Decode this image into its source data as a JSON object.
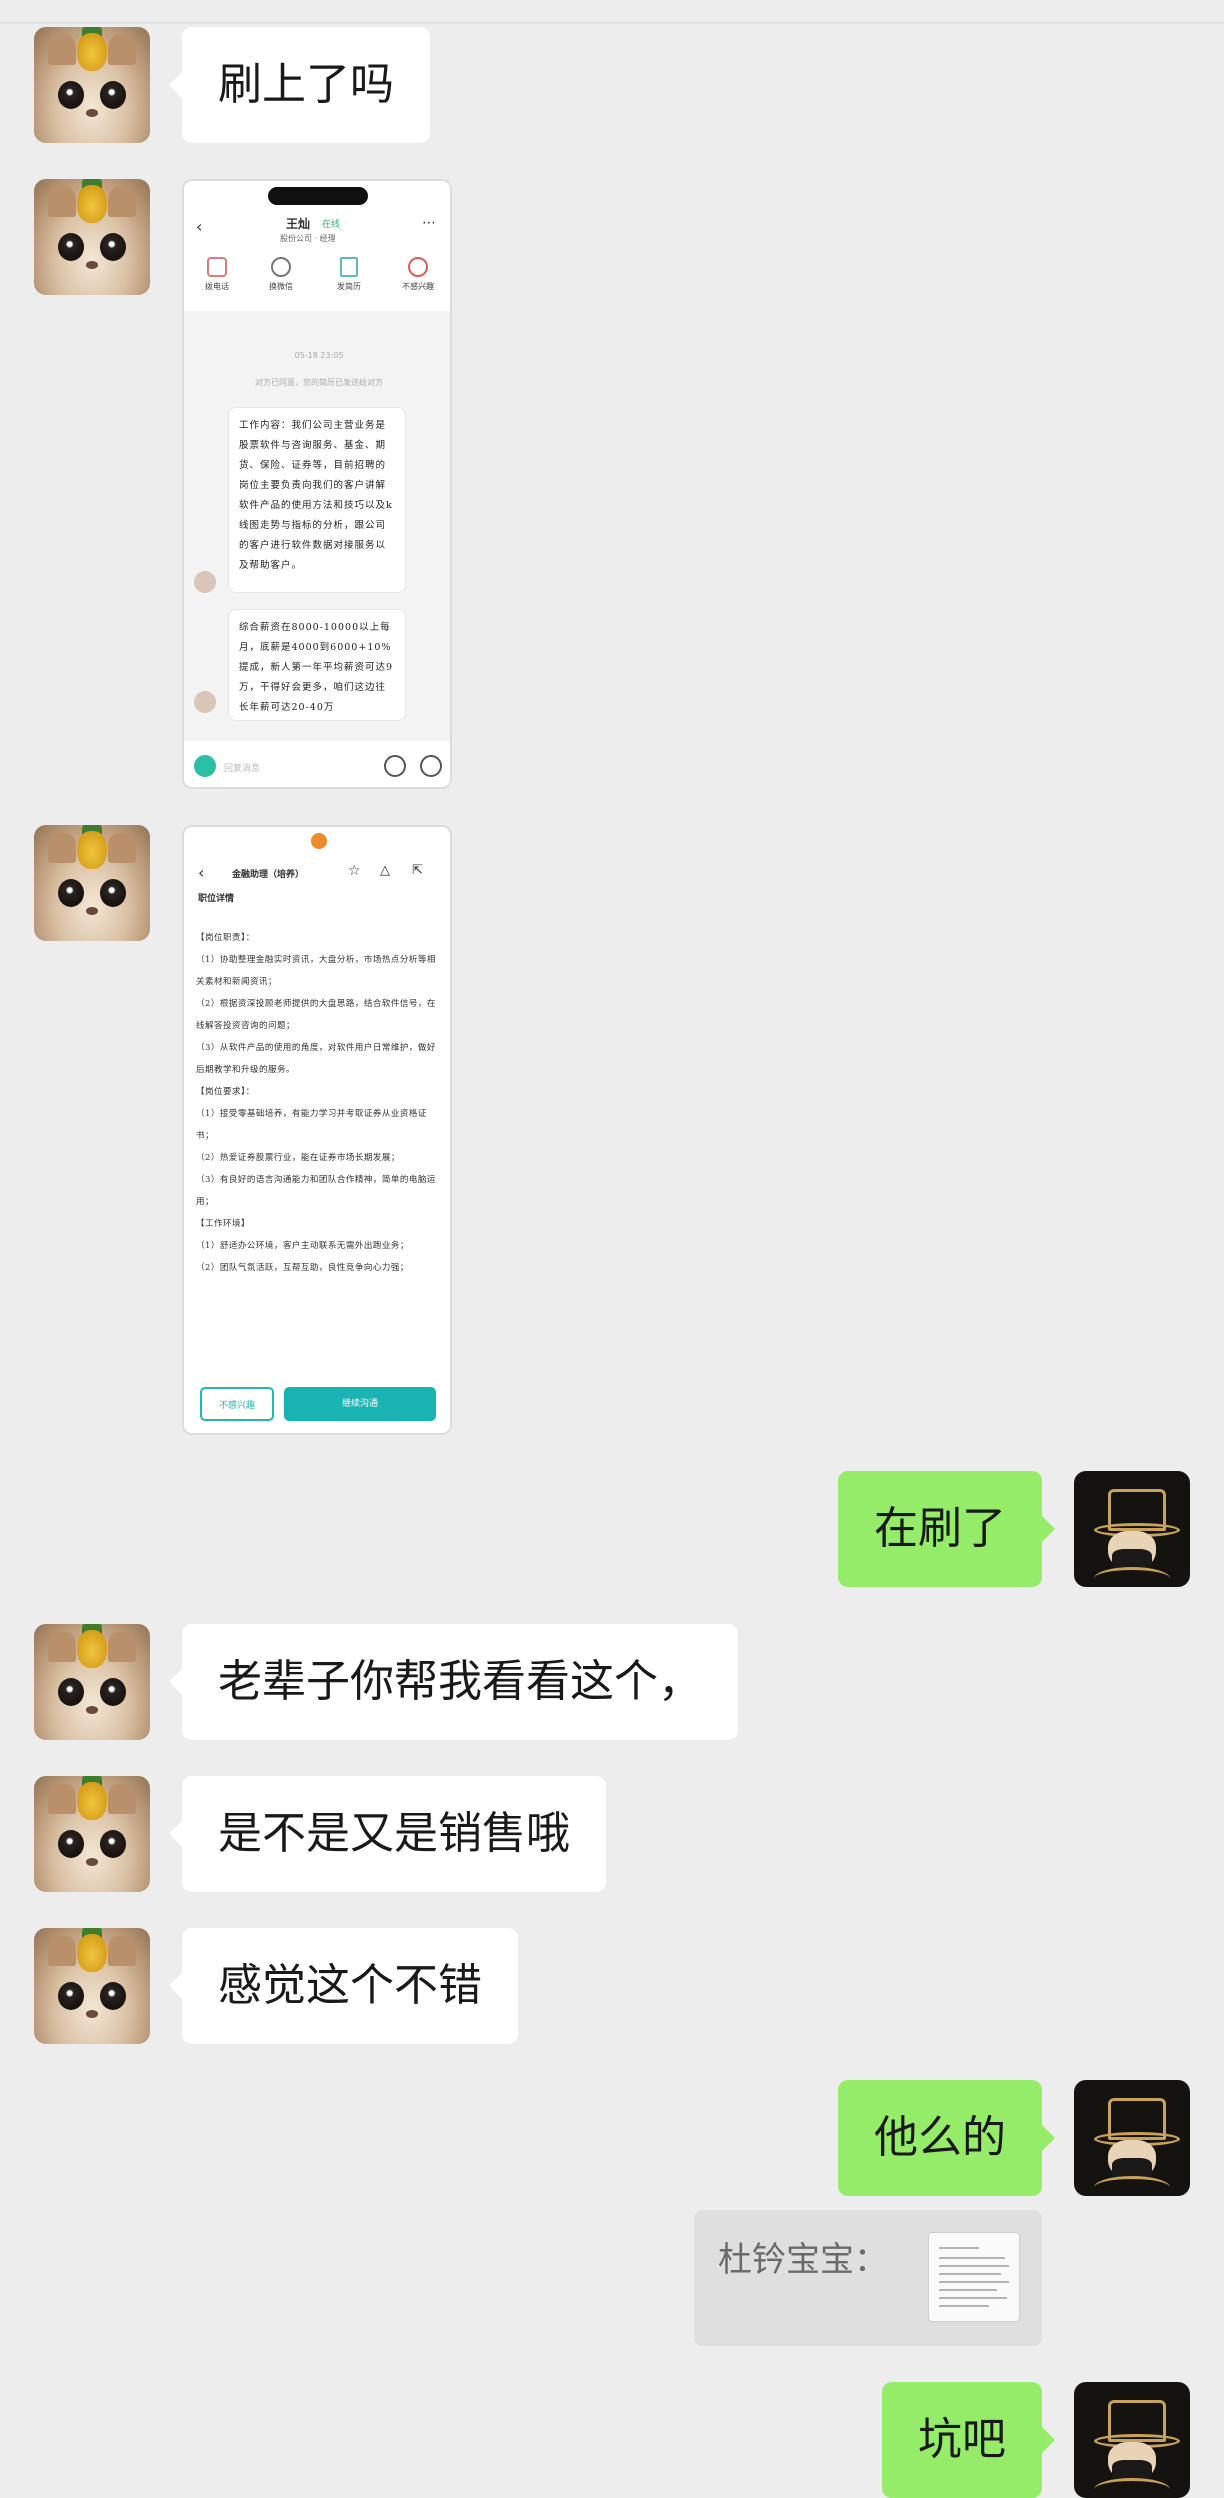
{
  "messages": [
    {
      "side": "in",
      "text": "刷上了吗"
    },
    {
      "side": "in",
      "type": "image",
      "label": "screenshot-chat"
    },
    {
      "side": "in",
      "type": "image",
      "label": "screenshot-job"
    },
    {
      "side": "out",
      "text": "在刷了"
    },
    {
      "side": "in",
      "text": "老辈子你帮我看看这个，"
    },
    {
      "side": "in",
      "text": "是不是又是销售哦"
    },
    {
      "side": "in",
      "text": "感觉这个不错"
    },
    {
      "side": "out",
      "text": "他么的"
    },
    {
      "side": "out",
      "type": "quote",
      "text": "杜钤宝宝："
    },
    {
      "side": "out",
      "text": "坑吧"
    }
  ],
  "shot1": {
    "name": "王灿",
    "online": "在线",
    "subtitle": "股份公司 · 经理",
    "actions": [
      "拨电话",
      "换微信",
      "发简历",
      "不感兴趣"
    ],
    "timestamp": "05-18 23:05",
    "notice": "对方已同意，您的简历已发送给对方",
    "bubble1": "工作内容：我们公司主营业务是股票软件与咨询服务、基金、期货、保险、证券等，目前招聘的岗位主要负责向我们的客户讲解软件产品的使用方法和技巧以及k线图走势与指标的分析，跟公司的客户进行软件数据对接服务以及帮助客户。",
    "bubble2": "综合薪资在8000-10000以上每月，底薪是4000到6000+10%提成，新人第一年平均薪资可达9万，干得好会更多，咱们这边往长年薪可达20-40万",
    "input_placeholder": "回复消息"
  },
  "shot2": {
    "title": "金融助理（培养）",
    "section": "职位详情",
    "lines": [
      "【岗位职责】：",
      "（1）协助整理金融实时资讯，大盘分析，市场热点分析等相关素材和新闻资讯；",
      "（2）根据资深投顾老师提供的大盘思路，结合软件信号，在线解答投资咨询的问题；",
      "（3）从软件产品的使用的角度，对软件用户日常维护，做好后期教学和升级的服务。",
      "【岗位要求】：",
      "（1）接受零基础培养，有能力学习并考取证券从业资格证书；",
      "（2）热爱证券股票行业，能在证券市场长期发展；",
      "（3）有良好的语言沟通能力和团队合作精神，简单的电脑运用；",
      "【工作环境】",
      "（1）舒适办公环境，客户主动联系无需外出跑业务；",
      "（2）团队气氛活跃，互帮互助，良性竞争向心力强；"
    ],
    "btn_left": "不感兴趣",
    "btn_right": "继续沟通"
  }
}
